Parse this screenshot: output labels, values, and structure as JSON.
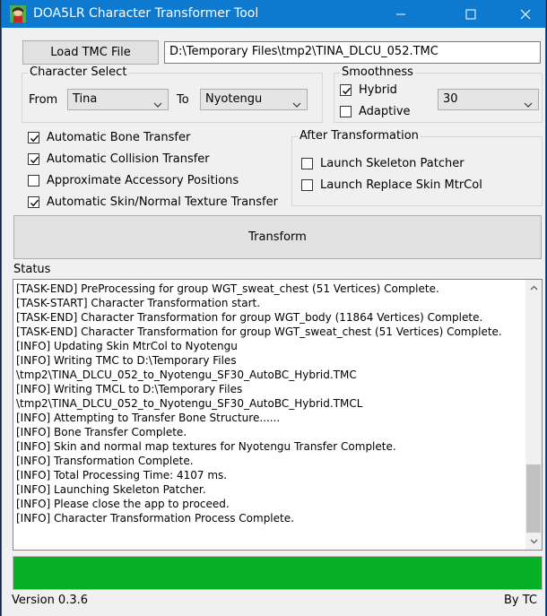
{
  "window": {
    "title": "DOA5LR Character Transformer Tool",
    "icon": "green-character-icon",
    "controls": [
      "minimize-icon",
      "maximize-icon",
      "close-icon"
    ],
    "title_bar_color": "#0d7ad0"
  },
  "load": {
    "button_label": "Load TMC File",
    "file_path": "D:\\Temporary Files\\tmp2\\TINA_DLCU_052.TMC"
  },
  "character_select": {
    "title": "Character Select",
    "from_label": "From",
    "from_value": "Tina",
    "to_label": "To",
    "to_value": "Nyotengu"
  },
  "smoothness": {
    "title": "Smoothness",
    "hybrid": {
      "label": "Hybrid",
      "checked": true
    },
    "adaptive": {
      "label": "Adaptive",
      "checked": false
    },
    "value": "30"
  },
  "options": [
    {
      "label": "Automatic Bone Transfer",
      "checked": true
    },
    {
      "label": "Automatic Collision Transfer",
      "checked": true
    },
    {
      "label": "Approximate Accessory Positions",
      "checked": false
    },
    {
      "label": "Automatic Skin/Normal Texture Transfer",
      "checked": true
    }
  ],
  "after_transformation": {
    "title": "After Transformation",
    "launch_skeleton_patcher": {
      "label": "Launch Skeleton Patcher",
      "checked": false
    },
    "launch_replace_skin": {
      "label": "Launch Replace Skin MtrCol",
      "checked": false
    }
  },
  "transform_button": "Transform",
  "status": {
    "label": "Status",
    "lines": [
      "[TASK-END] PreProcessing for group WGT_sweat_chest (51 Vertices) Complete.",
      "[TASK-START] Character Transformation start.",
      "[TASK-END] Character Transformation for group WGT_body (11864 Vertices) Complete.",
      "[TASK-END] Character Transformation for group WGT_sweat_chest (51 Vertices) Complete.",
      "[INFO] Updating Skin MtrCol to Nyotengu",
      "[INFO] Writing TMC to D:\\Temporary Files",
      "\\tmp2\\TINA_DLCU_052_to_Nyotengu_SF30_AutoBC_Hybrid.TMC",
      "[INFO] Writing TMCL to D:\\Temporary Files",
      "\\tmp2\\TINA_DLCU_052_to_Nyotengu_SF30_AutoBC_Hybrid.TMCL",
      "[INFO] Attempting to Transfer Bone Structure......",
      "[INFO] Bone Transfer Complete.",
      "[INFO] Skin and normal map textures for Nyotengu Transfer Complete.",
      "[INFO] Transformation Complete.",
      "[INFO] Total Processing Time: 4107 ms.",
      "[INFO] Launching Skeleton Patcher.",
      "[INFO] Please close the app to proceed.",
      "[INFO] Character Transformation Process Complete."
    ]
  },
  "progress": {
    "value_fraction": 1.0,
    "color": "#06b025"
  },
  "footer": {
    "version": "Version 0.3.6",
    "author": "By TC"
  }
}
